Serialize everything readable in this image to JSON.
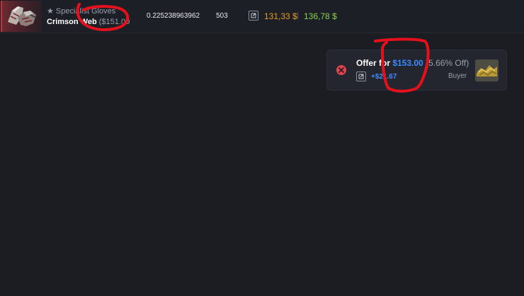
{
  "item": {
    "type": "★ Specialist Gloves",
    "name": "Crimson Web",
    "price": "($151.00",
    "float": "0.225238963962",
    "count": "503",
    "price_low": "131,33 $",
    "separator": "|",
    "price_high": "136,78 $"
  },
  "offer": {
    "prefix": "Offer for",
    "amount": "$153.00",
    "discount": "(5.66% Off)",
    "diff": "+$21.67",
    "role": "Buyer"
  },
  "colors": {
    "background": "#1b1d23",
    "accent_blue": "#3d8bff",
    "price_orange": "#e79d25",
    "price_green": "#8bd34b",
    "cancel_red": "#e0434d",
    "annotation_red": "#e4111c"
  },
  "icons": {
    "external": "external-link-icon",
    "cancel": "close-circle-icon"
  }
}
